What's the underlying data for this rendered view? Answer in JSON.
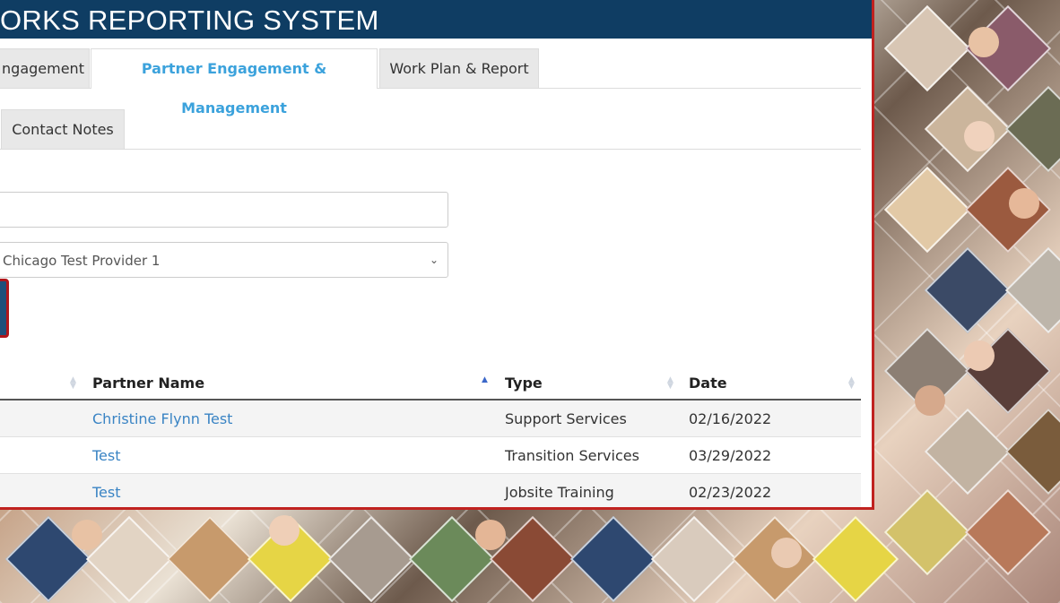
{
  "app": {
    "title": "ORKS REPORTING SYSTEM"
  },
  "tabs": [
    {
      "label": "ngagement",
      "active": false
    },
    {
      "label": "Partner Engagement & Management",
      "active": true
    },
    {
      "label": "Work Plan & Report",
      "active": false
    }
  ],
  "subtabs": [
    {
      "label": "Contact Notes"
    }
  ],
  "form": {
    "text_field_value": "",
    "provider_select_value": "Chicago Test Provider 1"
  },
  "table": {
    "columns": [
      {
        "label": "",
        "sort": "none"
      },
      {
        "label": "Partner Name",
        "sort": "asc"
      },
      {
        "label": "Type",
        "sort": "none"
      },
      {
        "label": "Date",
        "sort": "none"
      }
    ],
    "rows": [
      {
        "partner": "Christine Flynn Test",
        "type": "Support Services",
        "date": "02/16/2022"
      },
      {
        "partner": "Test",
        "type": "Transition Services",
        "date": "03/29/2022"
      },
      {
        "partner": "Test",
        "type": "Jobsite Training",
        "date": "02/23/2022"
      }
    ]
  },
  "colors": {
    "header": "#0f3d63",
    "active_tab": "#3ba2dc",
    "link": "#3a84c4",
    "frame": "#c0221f"
  }
}
